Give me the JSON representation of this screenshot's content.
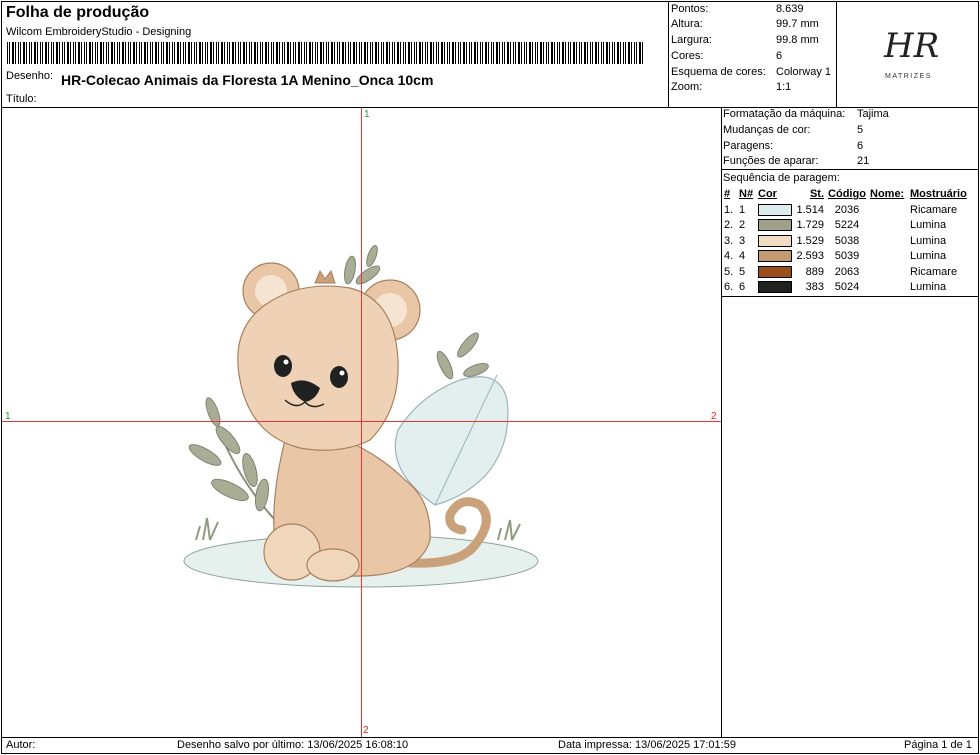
{
  "header": {
    "title": "Folha de produção",
    "software": "Wilcom EmbroideryStudio - Designing",
    "design_label": "Desenho:",
    "design_name": "HR-Colecao Animais da Floresta 1A Menino_Onca 10cm",
    "title_label": "Título:"
  },
  "stats": [
    {
      "label": "Pontos:",
      "value": "8.639"
    },
    {
      "label": "Altura:",
      "value": "99.7 mm"
    },
    {
      "label": "Largura:",
      "value": "99.8 mm"
    },
    {
      "label": "Cores:",
      "value": "6"
    },
    {
      "label": "Esquema de cores:",
      "value": "Colorway 1"
    },
    {
      "label": "Zoom:",
      "value": "1:1"
    }
  ],
  "logo": {
    "mark": "HR",
    "sub": "MATRIZES"
  },
  "machine": [
    {
      "label": "Formatação da máquina:",
      "value": "Tajima"
    },
    {
      "label": "Mudanças de cor:",
      "value": "5"
    },
    {
      "label": "Paragens:",
      "value": "6"
    },
    {
      "label": "Funções de aparar:",
      "value": "21"
    }
  ],
  "sequence": {
    "title": "Sequência de paragem:",
    "headers": [
      "#",
      "N#",
      "Cor",
      "St.",
      "Código",
      "Nome:",
      "Mostruário"
    ],
    "rows": [
      {
        "idx": "1.",
        "n": "1",
        "color": "#dcecec",
        "st": "1.514",
        "code": "2036",
        "name": "",
        "chart": "Ricamare"
      },
      {
        "idx": "2.",
        "n": "2",
        "color": "#9ea088",
        "st": "1.729",
        "code": "5224",
        "name": "",
        "chart": "Lumina"
      },
      {
        "idx": "3.",
        "n": "3",
        "color": "#f3dcc4",
        "st": "1.529",
        "code": "5038",
        "name": "",
        "chart": "Lumina"
      },
      {
        "idx": "4.",
        "n": "4",
        "color": "#c49a72",
        "st": "2.593",
        "code": "5039",
        "name": "",
        "chart": "Lumina"
      },
      {
        "idx": "5.",
        "n": "5",
        "color": "#9a4e1a",
        "st": "889",
        "code": "2063",
        "name": "",
        "chart": "Ricamare"
      },
      {
        "idx": "6.",
        "n": "6",
        "color": "#1f2220",
        "st": "383",
        "code": "5024",
        "name": "",
        "chart": "Lumina"
      }
    ]
  },
  "canvas": {
    "marker_top": "1",
    "marker_bottom": "2",
    "marker_left": "1",
    "marker_right": "2"
  },
  "footer": {
    "author": "Autor:",
    "saved": "Desenho salvo por último: 13/06/2025 16:08:10",
    "printed": "Data impressa: 13/06/2025 17:01:59",
    "page": "Página 1 de 1"
  }
}
